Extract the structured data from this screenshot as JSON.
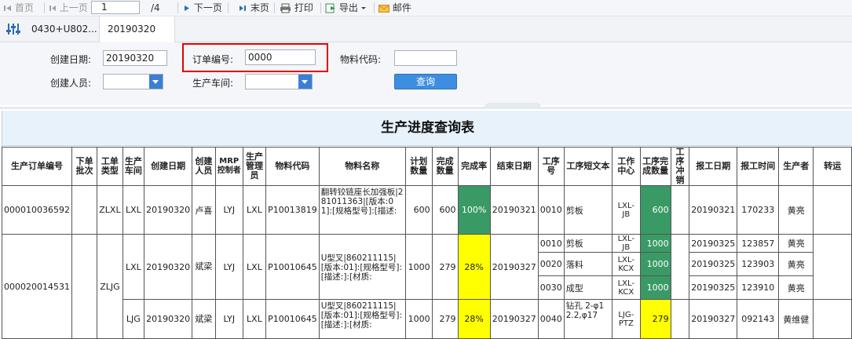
{
  "toolbar": {
    "first": "首页",
    "prev": "上一页",
    "page_value": "1",
    "page_total": "/4",
    "next": "下一页",
    "last": "末页",
    "print": "打印",
    "export": "导出",
    "mail": "邮件"
  },
  "tabs": [
    {
      "label": "0430+U802..."
    },
    {
      "label": "20190320"
    }
  ],
  "form": {
    "created_date_label": "创建日期:",
    "created_date_value": "20190320",
    "order_no_label": "订单编号:",
    "order_no_value": "0000",
    "material_code_label": "物料代码:",
    "material_code_value": "",
    "creator_label": "创建人员:",
    "workshop_label": "生产车间:",
    "query_button": "查询"
  },
  "report": {
    "title": "生产进度查询表",
    "headers": [
      "生产订单编号",
      "下单批次",
      "工单类型",
      "生产车间",
      "创建日期",
      "创建人员",
      "MRP控制者",
      "生产管理员",
      "物料代码",
      "物料名称",
      "计划数量",
      "完成数量",
      "完成率",
      "结束日期",
      "工序号",
      "工序短文本",
      "工作中心",
      "工序完成数量",
      "工序冲销",
      "报工日期",
      "报工时间",
      "生产者",
      "转运"
    ],
    "rows": [
      {
        "order_no": "000010036592",
        "type": "ZLXL",
        "workshop": "LXL",
        "created": "20190320",
        "creator": "卢喜",
        "mrp": "LYJ",
        "manager": "LXL",
        "material_code": "P10013819",
        "material_name": "翻转铰链座长加强板|281011363|[版本:01]:[规格型号]:[描述:",
        "plan_qty": "600",
        "done_qty": "600",
        "rate": "100%",
        "end_date": "20190321",
        "ops": [
          {
            "op_no": "0010",
            "op_text": "剪板",
            "center": "LXL-JB",
            "op_qty": "600",
            "report_date": "20190321",
            "report_time": "170233",
            "producer": "黄亮"
          }
        ]
      },
      {
        "order_no": "000020014531",
        "type": "ZLJG",
        "workshop": "LXL",
        "created": "20190320",
        "creator": "斌梁",
        "mrp": "LYJ",
        "manager": "LXL",
        "material_code": "P10010645",
        "material_name": "U型叉|860211115|[版本:01]:[规格型号]:[描述:]:[材质:",
        "plan_qty": "1000",
        "done_qty": "279",
        "rate": "28%",
        "end_date": "20190327",
        "ops": [
          {
            "op_no": "0010",
            "op_text": "剪板",
            "center": "LXL-JB",
            "op_qty": "1000",
            "report_date": "20190325",
            "report_time": "123857",
            "producer": "黄亮"
          },
          {
            "op_no": "0020",
            "op_text": "落料",
            "center": "LXL-KCX",
            "op_qty": "1000",
            "report_date": "20190325",
            "report_time": "123903",
            "producer": "黄亮"
          },
          {
            "op_no": "0030",
            "op_text": "成型",
            "center": "LXL-KCX",
            "op_qty": "1000",
            "report_date": "20190325",
            "report_time": "123910",
            "producer": "黄亮"
          }
        ]
      },
      {
        "workshop": "LJG",
        "created": "20190320",
        "creator": "斌梁",
        "mrp": "LYJ",
        "manager": "LXL",
        "material_code": "P10010645",
        "material_name": "U型叉|860211115|[版本:01]:[规格型号]:[描述:]:[材质:",
        "plan_qty": "1000",
        "done_qty": "279",
        "rate": "28%",
        "end_date": "20190327",
        "ops": [
          {
            "op_no": "0040",
            "op_text": "钻孔 2-φ12.2,φ17",
            "center": "LJG-PTZ",
            "op_qty": "279",
            "report_date": "20190327",
            "report_time": "092143",
            "producer": "黄维健"
          }
        ]
      }
    ]
  },
  "colors": {
    "green": "#3a9a66",
    "yellow": "#ffff00",
    "accent": "#3d8ee0",
    "highlight_box": "#e60000"
  }
}
